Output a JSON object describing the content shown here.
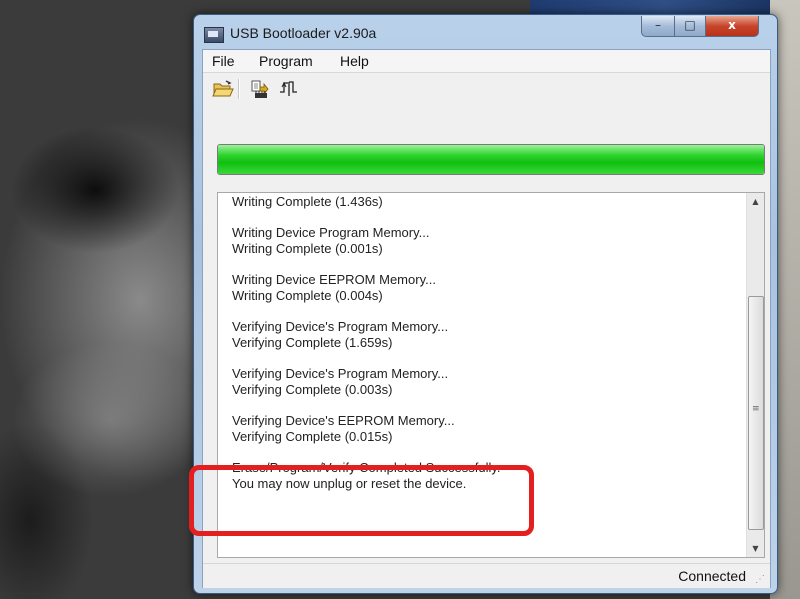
{
  "window": {
    "title": "USB Bootloader v2.90a",
    "controls": {
      "minimize": "–",
      "maximize": "□",
      "close": "x"
    }
  },
  "menu": [
    "File",
    "Program",
    "Help"
  ],
  "toolbar": {
    "items": [
      "open-file-icon",
      "write-device-icon",
      "reset-device-icon"
    ]
  },
  "progress": {
    "fraction": 1.0,
    "color": "#17c617"
  },
  "log": {
    "entries": [
      [
        "Writing Complete (1.436s)"
      ],
      [
        "Writing Device Program Memory...",
        "Writing Complete (0.001s)"
      ],
      [
        "Writing Device EEPROM Memory...",
        "Writing Complete (0.004s)"
      ],
      [
        "Verifying Device's Program Memory...",
        "Verifying Complete (1.659s)"
      ],
      [
        "Verifying Device's Program Memory...",
        "Verifying Complete (0.003s)"
      ],
      [
        "Verifying Device's EEPROM Memory...",
        "Verifying Complete (0.015s)"
      ],
      [
        "Erase/Program/Verify Completed Successfully.",
        "You may now unplug or reset the device."
      ]
    ],
    "scroll": {
      "up": "▲",
      "down": "▼",
      "grip": "≡"
    }
  },
  "status": {
    "text": "Connected"
  },
  "highlight": {
    "color": "#e41f1f"
  }
}
